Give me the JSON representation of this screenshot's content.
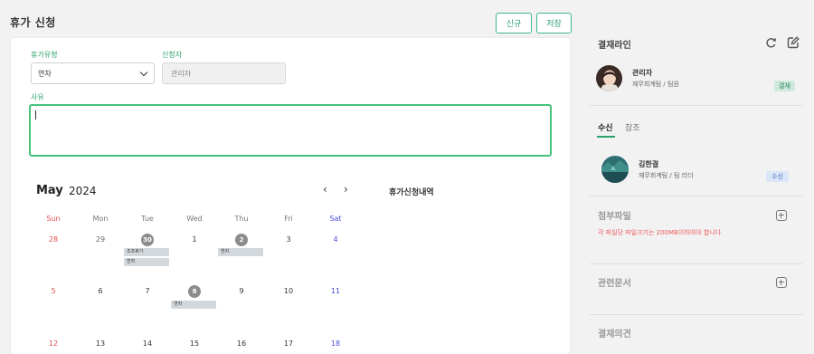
{
  "header": {
    "title": "휴가 신청",
    "new_label": "신규",
    "save_label": "저장"
  },
  "form": {
    "leave_type_label": "휴가유형",
    "leave_type_value": "연차",
    "applicant_label": "신청자",
    "applicant_value": "관리자",
    "reason_label": "사유",
    "reason_value": ""
  },
  "calendar": {
    "month": "May",
    "year": "2024",
    "prev": "‹",
    "next": "›",
    "weekdays": [
      "Sun",
      "Mon",
      "Tue",
      "Wed",
      "Thu",
      "Fri",
      "Sat"
    ],
    "weeks": [
      [
        "28",
        "29",
        "30",
        "1",
        "2",
        "3",
        "4"
      ],
      [
        "5",
        "6",
        "7",
        "8",
        "9",
        "10",
        "11"
      ],
      [
        "12",
        "13",
        "14",
        "15",
        "16",
        "17",
        "18"
      ]
    ],
    "events": {
      "tue_30_a": "조조휴가",
      "tue_30_b": "연차",
      "thu_2": "연차",
      "wed_8": "연차"
    }
  },
  "history": {
    "title": "휴가신청내역"
  },
  "sidebar": {
    "approval_title": "결재라인",
    "approver": {
      "name": "관리자",
      "dept": "재무회계팀 / 팀원",
      "badge": "결재"
    },
    "tab_receive": "수신",
    "tab_reference": "참조",
    "receiver": {
      "name": "김한결",
      "dept": "재무회계팀 / 팀 리더",
      "badge": "수신"
    },
    "attachments_title": "첨부파일",
    "attachments_warning": "각 파일당 파일크기는 200MB이하여야 합니다",
    "related_docs_title": "관련문서",
    "opinion_title": "결재의견"
  },
  "colors": {
    "accent": "#2aa36c",
    "focus_border": "#46c27c",
    "sunday": "#e05050",
    "saturday": "#4a4ad8",
    "warning": "#ef5a5a",
    "badge_approve_bg": "#cfe8dc",
    "badge_receive_bg": "#dbe7f8"
  }
}
